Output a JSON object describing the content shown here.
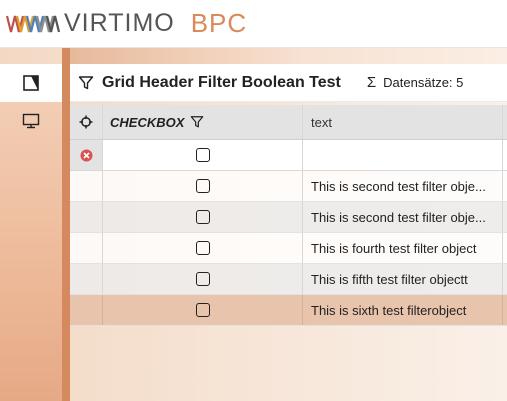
{
  "header": {
    "brand": "VIRTIMO",
    "product": "BPC"
  },
  "sidebar": {
    "items": [
      {
        "icon": "module-icon",
        "active": true
      },
      {
        "icon": "monitor-icon",
        "active": false
      }
    ]
  },
  "panel": {
    "title": "Grid Header Filter Boolean Test",
    "record_label": "Datensätze: 5"
  },
  "grid": {
    "columns": [
      {
        "label": ""
      },
      {
        "label": "CHECKBOX"
      },
      {
        "label": "text"
      }
    ],
    "rows": [
      {
        "checked": false,
        "text": "This is second test filter obje...",
        "selected": false
      },
      {
        "checked": false,
        "text": "This is second test filter obje...",
        "selected": false
      },
      {
        "checked": false,
        "text": "This is fourth test filter object",
        "selected": false
      },
      {
        "checked": false,
        "text": "This is fifth test filter objectt",
        "selected": false
      },
      {
        "checked": false,
        "text": "This is sixth test filterobject",
        "selected": true
      }
    ]
  },
  "colors": {
    "accent": "#d98a5a",
    "selected_row": "#e7c4ab",
    "clear_filter": "#d9534f"
  }
}
